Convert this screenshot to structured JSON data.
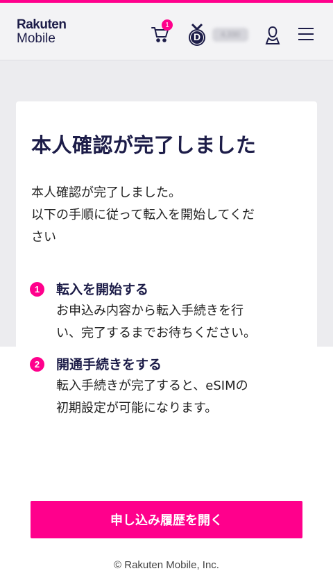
{
  "header": {
    "logo_line1": "Rakuten",
    "logo_line2": "Mobile",
    "cart_count": "1",
    "rank_letter": "D",
    "points": "4,330"
  },
  "card": {
    "title": "本人確認が完了しました",
    "lead": [
      "本人確認が完了しました。",
      "以下の手順に従って転入を開始してくだ\nさい"
    ],
    "steps": [
      {
        "num": "1",
        "title": "転入を開始する",
        "body": "お申込み内容から転入手続きを行\nい、完了するまでお待ちください。"
      },
      {
        "num": "2",
        "title": "開通手続きをする",
        "body": "転入手続きが完了すると、eSIMの\n初期設定が可能になります。"
      }
    ],
    "button_label": "申し込み履歴を開く"
  },
  "footer": {
    "copyright": "© Rakuten Mobile, Inc."
  },
  "colors": {
    "accent": "#ff008c",
    "navy": "#1c1c48",
    "background_gray": "#ececef"
  },
  "icons": [
    "cart-icon",
    "rank-medal-icon",
    "user-icon",
    "hamburger-menu-icon"
  ]
}
